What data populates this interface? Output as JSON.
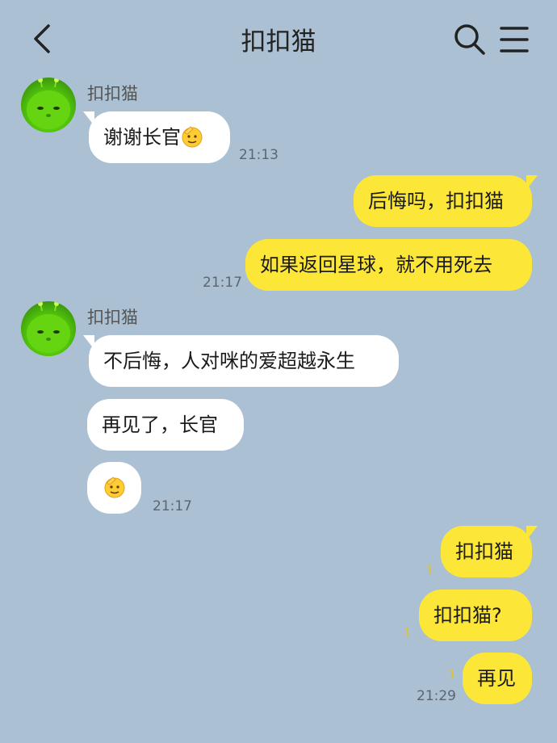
{
  "header": {
    "title": "扣扣猫",
    "back_icon": "chevron-left-icon",
    "search_icon": "search-icon",
    "menu_icon": "menu-icon"
  },
  "colors": {
    "background": "#abc1d3",
    "incoming_bubble": "#ffffff",
    "outgoing_bubble": "#fce637",
    "read_mark": "#e5c21a"
  },
  "messages": {
    "g1": {
      "sender": "扣扣猫",
      "m1_text": "谢谢长官",
      "m1_emoji": "saluting-face-icon",
      "time": "21:13"
    },
    "g2": {
      "m1_text": "后悔吗，扣扣猫",
      "m2_text": "如果返回星球，就不用死去",
      "time": "21:17"
    },
    "g3": {
      "sender": "扣扣猫",
      "m1_text": "不后悔，人对咪的爱超越永生",
      "m2_text": "再见了，长官",
      "m3_emoji": "saluting-face-icon",
      "time": "21:17"
    },
    "g4": {
      "m1_text": "扣扣猫",
      "m1_read": "1",
      "m2_text": "扣扣猫?",
      "m2_read": "1",
      "m3_text": "再见",
      "m3_read": "1",
      "time": "21:29"
    }
  }
}
